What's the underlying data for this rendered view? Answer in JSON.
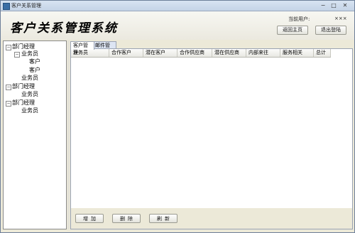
{
  "window": {
    "title": "客户关系管理"
  },
  "header": {
    "system_title": "客户关系管理系统",
    "current_user_label": "当前用户:",
    "current_user_value": "×××",
    "home_button": "返回主页",
    "logout_button": "退出登陆"
  },
  "tree": {
    "nodes": [
      {
        "label": "部门经理",
        "expanded": true
      },
      {
        "label": "业务员",
        "expanded": true
      },
      {
        "label": "客户"
      },
      {
        "label": "客户"
      },
      {
        "label": "业务员"
      },
      {
        "label": "部门经理",
        "expanded": true
      },
      {
        "label": "业务员"
      },
      {
        "label": "部门经理",
        "expanded": true
      },
      {
        "label": "业务员"
      }
    ]
  },
  "tabs": [
    {
      "label": "客户管理",
      "active": true
    },
    {
      "label": "邮件管理",
      "active": false
    }
  ],
  "grid": {
    "columns": [
      "业务员",
      "合作客户",
      "潜在客户",
      "合作供应商",
      "潜在供应商",
      "内部来往",
      "服务相关",
      "总计"
    ]
  },
  "actions": {
    "add": "增加",
    "delete": "删除",
    "refresh": "刷新"
  },
  "colors": {
    "window_border": "#6d7f99",
    "active_tab_bg": "#ffffff",
    "inactive_tab_bg": "#dde5f3"
  }
}
